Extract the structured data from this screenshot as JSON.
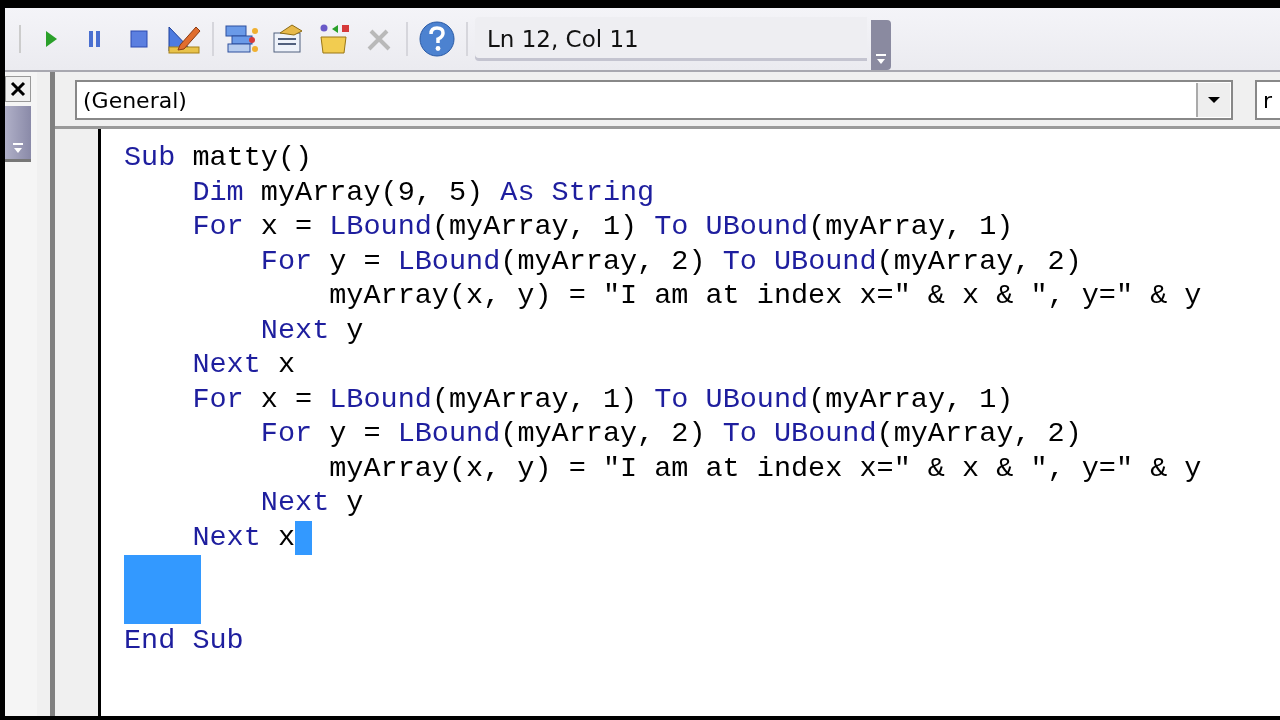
{
  "toolbar": {
    "position": "Ln 12, Col 11"
  },
  "object_combo": {
    "value": "(General)"
  },
  "procedure_combo": {
    "value": "r"
  },
  "code_lines": [
    {
      "selected": false,
      "tokens": [
        {
          "kind": "keyword",
          "text": "Sub"
        },
        {
          "kind": "plain",
          "text": " matty()"
        }
      ]
    },
    {
      "selected": false,
      "tokens": [
        {
          "kind": "keyword",
          "text": "    Dim"
        },
        {
          "kind": "plain",
          "text": " myArray(9, 5) "
        },
        {
          "kind": "keyword",
          "text": "As String"
        }
      ]
    },
    {
      "selected": false,
      "tokens": [
        {
          "kind": "keyword",
          "text": "    For"
        },
        {
          "kind": "plain",
          "text": " x = "
        },
        {
          "kind": "keyword",
          "text": "LBound"
        },
        {
          "kind": "plain",
          "text": "(myArray, 1) "
        },
        {
          "kind": "keyword",
          "text": "To UBound"
        },
        {
          "kind": "plain",
          "text": "(myArray, 1)"
        }
      ]
    },
    {
      "selected": false,
      "tokens": [
        {
          "kind": "keyword",
          "text": "        For"
        },
        {
          "kind": "plain",
          "text": " y = "
        },
        {
          "kind": "keyword",
          "text": "LBound"
        },
        {
          "kind": "plain",
          "text": "(myArray, 2) "
        },
        {
          "kind": "keyword",
          "text": "To UBound"
        },
        {
          "kind": "plain",
          "text": "(myArray, 2)"
        }
      ]
    },
    {
      "selected": false,
      "tokens": [
        {
          "kind": "plain",
          "text": "            myArray(x, y) = \"I am at index x=\" & x & \", y=\" & y"
        }
      ]
    },
    {
      "selected": false,
      "tokens": [
        {
          "kind": "keyword",
          "text": "        Next"
        },
        {
          "kind": "plain",
          "text": " y"
        }
      ]
    },
    {
      "selected": false,
      "tokens": [
        {
          "kind": "keyword",
          "text": "    Next"
        },
        {
          "kind": "plain",
          "text": " x"
        }
      ]
    },
    {
      "selected": false,
      "tokens": [
        {
          "kind": "keyword",
          "text": "    For"
        },
        {
          "kind": "plain",
          "text": " x = "
        },
        {
          "kind": "keyword",
          "text": "LBound"
        },
        {
          "kind": "plain",
          "text": "(myArray, 1) "
        },
        {
          "kind": "keyword",
          "text": "To UBound"
        },
        {
          "kind": "plain",
          "text": "(myArray, 1)"
        }
      ]
    },
    {
      "selected": false,
      "tokens": [
        {
          "kind": "keyword",
          "text": "        For"
        },
        {
          "kind": "plain",
          "text": " y = "
        },
        {
          "kind": "keyword",
          "text": "LBound"
        },
        {
          "kind": "plain",
          "text": "(myArray, 2) "
        },
        {
          "kind": "keyword",
          "text": "To UBound"
        },
        {
          "kind": "plain",
          "text": "(myArray, 2)"
        }
      ]
    },
    {
      "selected": false,
      "tokens": [
        {
          "kind": "plain",
          "text": "            myArray(x, y) = \"I am at index x=\" & x & \", y=\" & y"
        }
      ]
    },
    {
      "selected": false,
      "tokens": [
        {
          "kind": "keyword",
          "text": "        Next"
        },
        {
          "kind": "plain",
          "text": " y"
        }
      ]
    },
    {
      "selected": true,
      "tokens": [
        {
          "kind": "keyword",
          "text": "    Next"
        },
        {
          "kind": "plain",
          "text": " x"
        }
      ]
    },
    {
      "selected": true
    },
    {
      "selected": true
    },
    {
      "selected": false,
      "tokens": [
        {
          "kind": "keyword",
          "text": "End Sub"
        }
      ]
    }
  ]
}
